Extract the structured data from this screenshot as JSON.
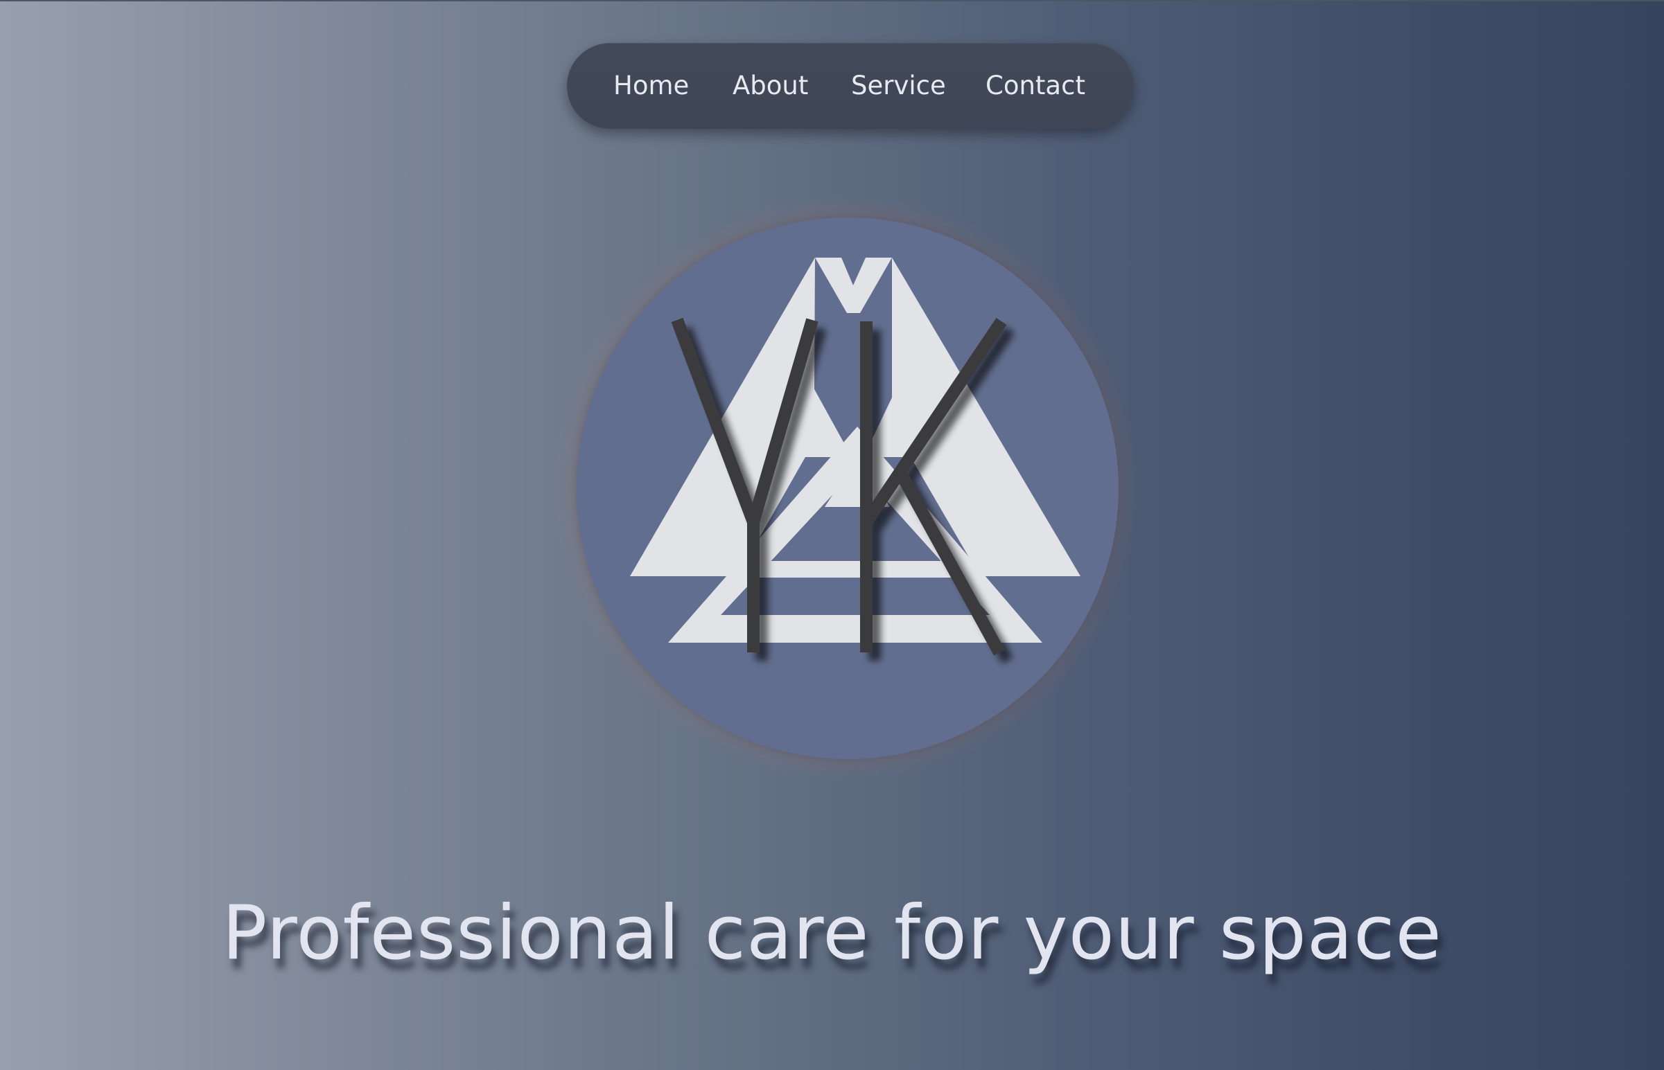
{
  "nav": {
    "items": [
      {
        "label": "Home"
      },
      {
        "label": "About"
      },
      {
        "label": "Service"
      },
      {
        "label": "Contact"
      }
    ]
  },
  "logo": {
    "text": "YK",
    "icon": "triangle-monogram-icon"
  },
  "hero": {
    "tagline": "Professional care for your space"
  },
  "colors": {
    "background_left": "#98a0ad",
    "background_right": "#36445e",
    "nav_bg": "#424a5a",
    "circle": "#626e8f",
    "glow": "#cd7d62",
    "triangle": "#e1e3e7",
    "monogram": "#3b3b3d",
    "tagline": "#e2e5f0"
  }
}
